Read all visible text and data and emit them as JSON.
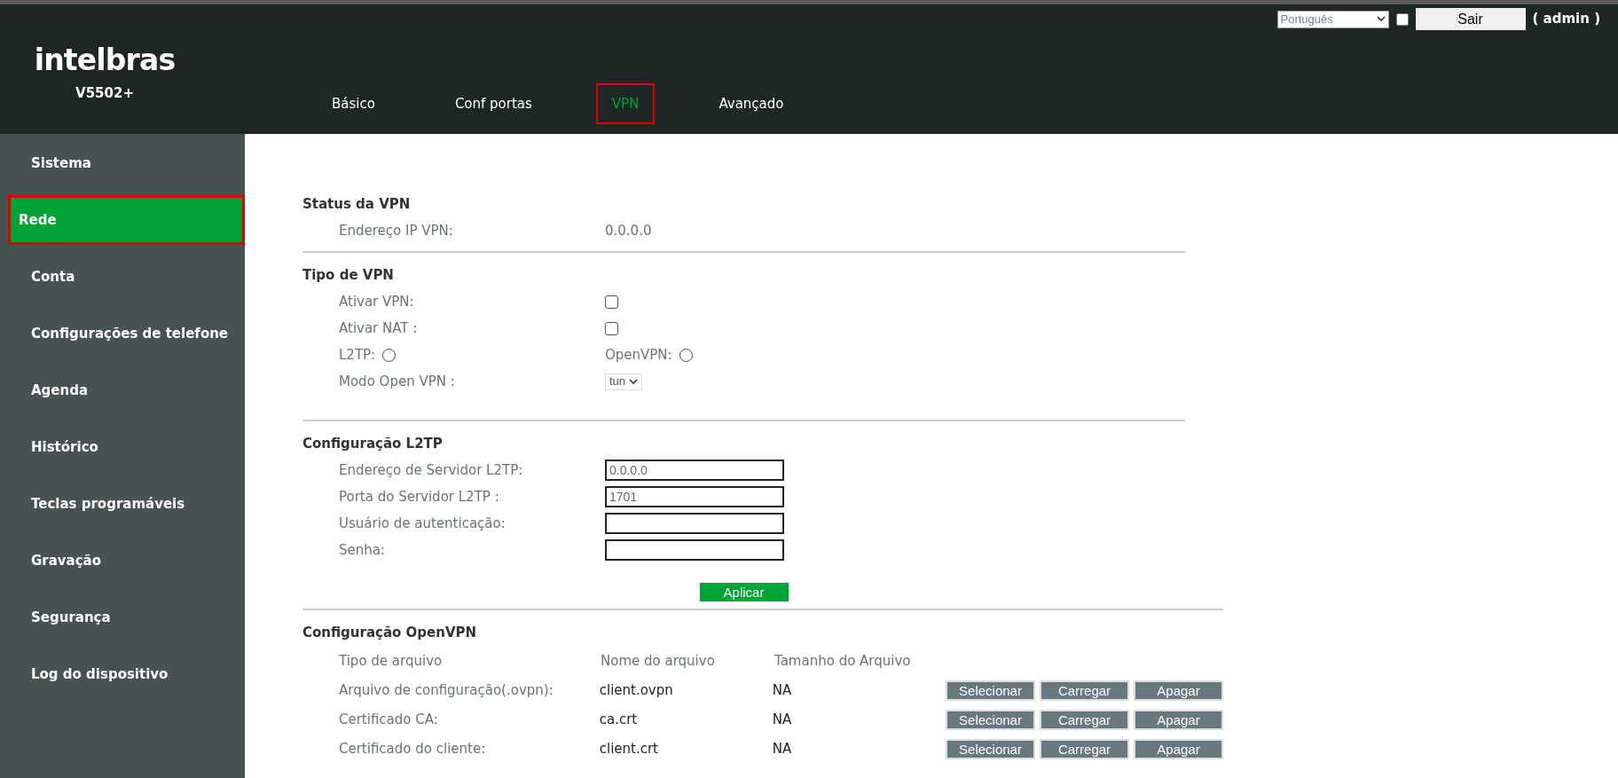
{
  "header": {
    "logo": "intelbras",
    "model": "V5502+",
    "language": "Português",
    "remember": {
      "checked": false
    },
    "logout": "Sair",
    "user": "( admin )",
    "tabs": [
      {
        "label": "Básico",
        "selected": false
      },
      {
        "label": "Conf portas",
        "selected": false
      },
      {
        "label": "VPN",
        "selected": true
      },
      {
        "label": "Avançado",
        "selected": false
      }
    ]
  },
  "sidebar": {
    "items": [
      {
        "label": "Sistema",
        "selected": false
      },
      {
        "label": "Rede",
        "selected": true
      },
      {
        "label": "Conta",
        "selected": false
      },
      {
        "label": "Configurações de telefone",
        "selected": false
      },
      {
        "label": "Agenda",
        "selected": false
      },
      {
        "label": "Histórico",
        "selected": false
      },
      {
        "label": "Teclas programáveis",
        "selected": false
      },
      {
        "label": "Gravação",
        "selected": false
      },
      {
        "label": "Segurança",
        "selected": false
      },
      {
        "label": "Log do dispositivo",
        "selected": false
      }
    ]
  },
  "sections": [
    {
      "title": "Status da VPN",
      "fields": [
        {
          "kind": "text",
          "label": "Endereço IP VPN:",
          "value": "0.0.0.0"
        }
      ]
    },
    {
      "title": "Tipo de VPN",
      "fields": [
        {
          "kind": "checkbox",
          "label": "Ativar VPN:",
          "checked": false
        },
        {
          "kind": "checkbox",
          "label": "Ativar NAT :",
          "checked": false
        },
        {
          "kind": "radios",
          "options": [
            {
              "label": "L2TP:",
              "selected": false
            },
            {
              "label": "OpenVPN:",
              "selected": false
            }
          ]
        },
        {
          "kind": "select",
          "label": "Modo Open VPN :",
          "value": "tun"
        }
      ]
    },
    {
      "title": "Configuração L2TP",
      "fields": [
        {
          "kind": "input",
          "label": "Endereço de Servidor L2TP:",
          "value": "0.0.0.0"
        },
        {
          "kind": "input",
          "label": "Porta do Servidor L2TP :",
          "value": "1701"
        },
        {
          "kind": "input",
          "label": "Usuário de autenticação:"
        },
        {
          "kind": "input",
          "label": "Senha:"
        }
      ],
      "apply": "Aplicar"
    }
  ],
  "openvpn": {
    "title": "Configuração OpenVPN",
    "columns": [
      "Tipo de arquivo",
      "Nome do arquivo",
      "Tamanho do Arquivo"
    ],
    "rows": [
      {
        "label": "Arquivo de configuração(.ovpn):",
        "file": "client.ovpn",
        "size": "NA",
        "actions": [
          "Selecionar",
          "Carregar",
          "Apagar"
        ]
      },
      {
        "label": "Certificado CA:",
        "file": "ca.crt",
        "size": "NA",
        "actions": [
          "Selecionar",
          "Carregar",
          "Apagar"
        ]
      },
      {
        "label": "Certificado do cliente:",
        "file": "client.crt",
        "size": "NA",
        "actions": [
          "Selecionar",
          "Carregar",
          "Apagar"
        ]
      }
    ]
  }
}
